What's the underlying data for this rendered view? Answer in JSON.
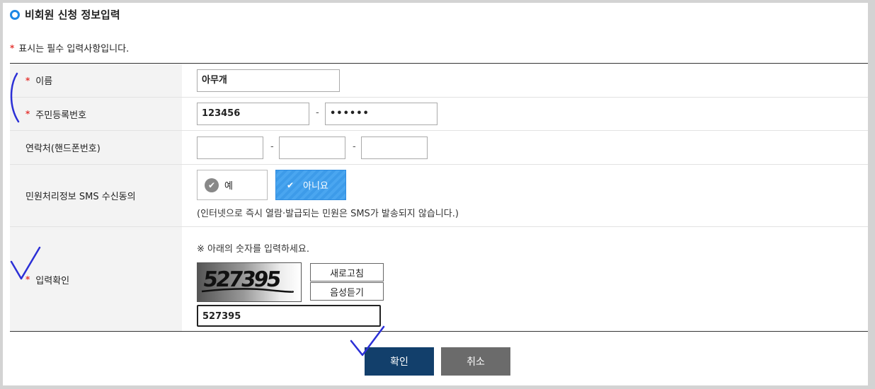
{
  "page": {
    "title": "비회원 신청 정보입력",
    "required_star": "*",
    "required_note": "표시는 필수 입력사항입니다."
  },
  "form": {
    "name": {
      "label": "이름",
      "value": "아무개"
    },
    "rrn": {
      "label": "주민등록번호",
      "front": "123456",
      "back": "••••••",
      "separator": "-"
    },
    "phone": {
      "label": "연락처(핸드폰번호)",
      "part1": "",
      "part2": "",
      "part3": "",
      "separator": "-"
    },
    "sms": {
      "label": "민원처리정보 SMS 수신동의",
      "yes_label": "예",
      "no_label": "아니요",
      "selected": "아니요",
      "note": "(인터넷으로 즉시 열람·발급되는 민원은 SMS가 발송되지 않습니다.)"
    },
    "captcha": {
      "label": "입력확인",
      "instruction": "※ 아래의 숫자를 입력하세요.",
      "image_text": "527395",
      "refresh_label": "새로고침",
      "audio_label": "음성듣기",
      "value": "527395"
    }
  },
  "actions": {
    "confirm_label": "확인",
    "cancel_label": "취소"
  },
  "colors": {
    "accent_blue": "#1e88e5",
    "required_red": "#e53935",
    "confirm_bg": "#123f6b",
    "cancel_bg": "#6b6b6b",
    "selected_radio": "#3d9be9"
  },
  "icons": {
    "title_bullet": "circle-bullet-icon",
    "radio_check": "check-circle-icon"
  }
}
